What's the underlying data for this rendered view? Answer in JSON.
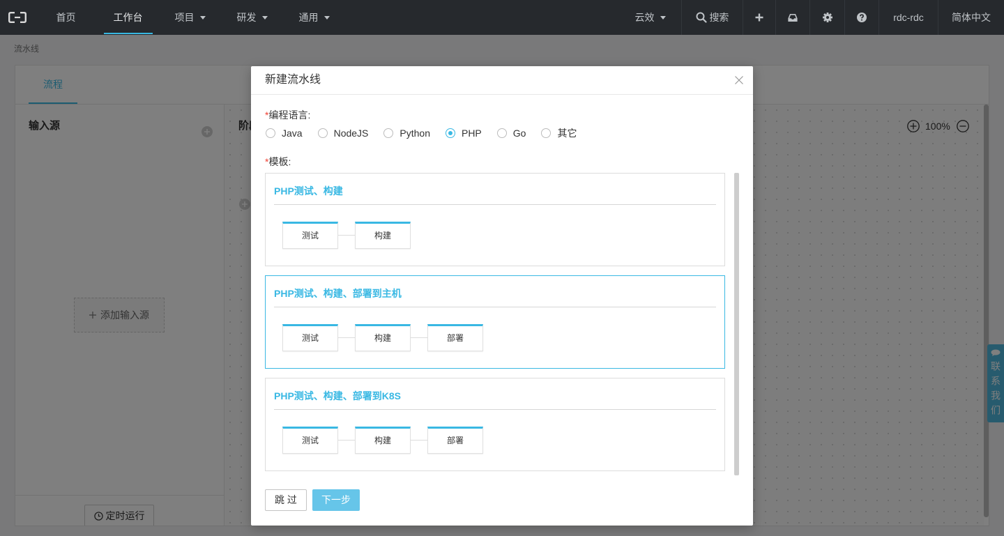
{
  "nav": {
    "logo_icon": "aliyun-logo-icon",
    "items": [
      {
        "label": "首页",
        "dropdown": false,
        "active": false
      },
      {
        "label": "工作台",
        "dropdown": false,
        "active": true
      },
      {
        "label": "项目",
        "dropdown": true,
        "active": false
      },
      {
        "label": "研发",
        "dropdown": true,
        "active": false
      },
      {
        "label": "通用",
        "dropdown": true,
        "active": false
      }
    ],
    "right": {
      "product": "云效",
      "search_icon": "search-icon",
      "search": "搜索",
      "add_icon": "plus-icon",
      "inbox_icon": "inbox-icon",
      "settings_icon": "gear-icon",
      "help_icon": "question-icon",
      "user": "rdc-rdc",
      "language": "简体中文"
    }
  },
  "breadcrumb": "流水线",
  "page": {
    "tab": "流程",
    "source_title": "输入源",
    "add_source": "添加输入源",
    "schedule": "定时运行",
    "stage_title": "阶段",
    "zoom": "100%"
  },
  "contact": "联系我们",
  "modal": {
    "title": "新建流水线",
    "required_mark": "*",
    "language_label": "编程语言:",
    "languages": [
      {
        "label": "Java",
        "checked": false
      },
      {
        "label": "NodeJS",
        "checked": false
      },
      {
        "label": "Python",
        "checked": false
      },
      {
        "label": "PHP",
        "checked": true
      },
      {
        "label": "Go",
        "checked": false
      },
      {
        "label": "其它",
        "checked": false
      }
    ],
    "template_label": "模板:",
    "templates": [
      {
        "title": "PHP测试、构建",
        "stages": [
          "测试",
          "构建"
        ],
        "selected": false
      },
      {
        "title": "PHP测试、构建、部署到主机",
        "stages": [
          "测试",
          "构建",
          "部署"
        ],
        "selected": true
      },
      {
        "title": "PHP测试、构建、部署到K8S",
        "stages": [
          "测试",
          "构建",
          "部署"
        ],
        "selected": false
      }
    ],
    "skip": "跳 过",
    "next": "下一步"
  },
  "colors": {
    "accent": "#39b8e3",
    "required": "#f04134",
    "nav_bg": "#26292d",
    "next_button": "#66c5e9",
    "contact_tab": "#4fb7dc"
  }
}
